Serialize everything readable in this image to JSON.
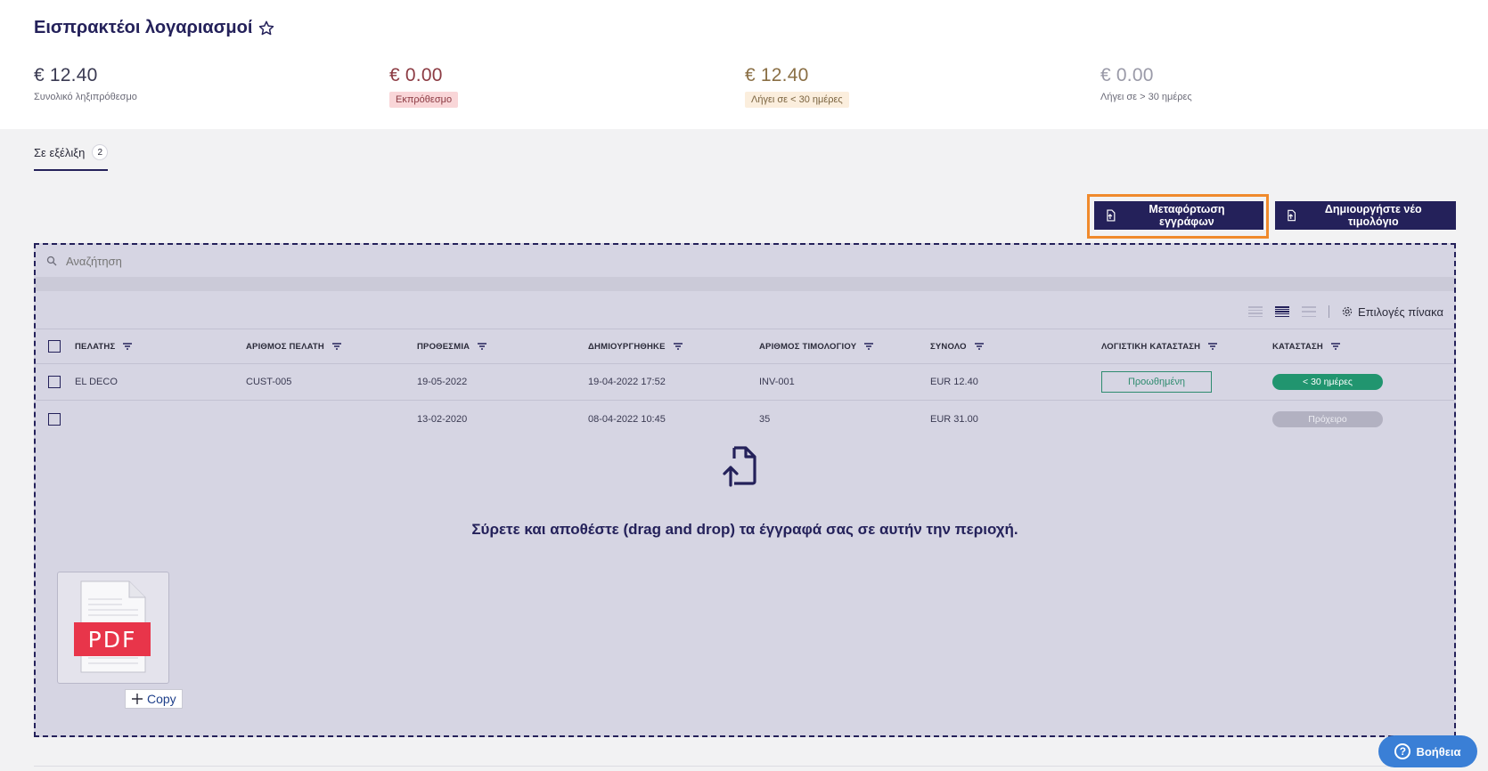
{
  "page": {
    "title": "Εισπρακτέοι λογαριασμοί"
  },
  "stats": [
    {
      "amount": "€ 12.40",
      "caption": "Συνολικό ληξιπρόθεσμο"
    },
    {
      "amount": "€ 0.00",
      "caption": "Εκπρόθεσμο"
    },
    {
      "amount": "€ 12.40",
      "caption": "Λήγει σε < 30 ημέρες"
    },
    {
      "amount": "€ 0.00",
      "caption": "Λήγει σε > 30 ημέρες"
    }
  ],
  "tabs": [
    {
      "label": "Σε εξέλιξη",
      "count": "2"
    }
  ],
  "actions": {
    "upload_label": "Μεταφόρτωση εγγράφων",
    "new_invoice_label": "Δημιουργήστε νέο τιμολόγιο"
  },
  "search": {
    "placeholder": "Αναζήτηση"
  },
  "toolbar": {
    "table_options_label": "Επιλογές πίνακα"
  },
  "table": {
    "columns": [
      "ΠΕΛΑΤΗΣ",
      "ΑΡΙΘΜΟΣ ΠΕΛΑΤΗ",
      "ΠΡΟΘΕΣΜΙΑ",
      "ΔΗΜΙΟΥΡΓΗΘΗΚΕ",
      "ΑΡΙΘΜΟΣ ΤΙΜΟΛΟΓΙΟΥ",
      "ΣΥΝΟΛΟ",
      "ΛΟΓΙΣΤΙΚΗ ΚΑΤΑΣΤΑΣΗ",
      "ΚΑΤΑΣΤΑΣΗ"
    ],
    "rows": [
      {
        "customer": "EL DECO",
        "customer_no": "CUST-005",
        "due": "19-05-2022",
        "created": "19-04-2022 17:52",
        "invoice_no": "INV-001",
        "total": "EUR 12.40",
        "accounting_status": "Προωθημένη",
        "status": "< 30 ημέρες"
      },
      {
        "customer": "",
        "customer_no": "",
        "due": "13-02-2020",
        "created": "08-04-2022 10:45",
        "invoice_no": "35",
        "total": "EUR 31.00",
        "accounting_status": "",
        "status": "Πρόχειρο"
      }
    ]
  },
  "dropzone": {
    "message": "Σύρετε και αποθέστε (drag and drop) τα έγγραφά σας σε αυτήν την περιοχή."
  },
  "drag": {
    "file_badge": "PDF",
    "copy_label": "Copy"
  },
  "help": {
    "label": "Βοήθεια"
  },
  "colors": {
    "primary": "#24215a",
    "highlight": "#f08a2c",
    "success": "#21956f",
    "help": "#3a7fd6"
  }
}
